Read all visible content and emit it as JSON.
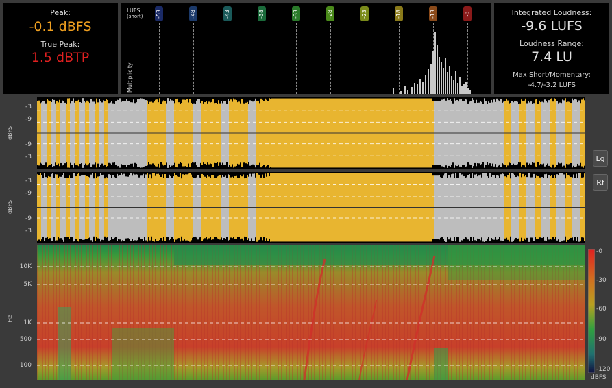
{
  "peak": {
    "peak_label": "Peak:",
    "peak_value": "-0.1 dBFS",
    "true_peak_label": "True Peak:",
    "true_peak_value": "1.5 dBTP"
  },
  "histogram": {
    "axis_label_line1": "LUFS",
    "axis_label_line2": "(short)",
    "y_label": "Multiplicity",
    "ticks": [
      {
        "label": "-53",
        "color": "#1a2a66"
      },
      {
        "label": "-48",
        "color": "#1c3a6a"
      },
      {
        "label": "-43",
        "color": "#1a5a5a"
      },
      {
        "label": "-38",
        "color": "#1a6a3a"
      },
      {
        "label": "-33",
        "color": "#2a7a2a"
      },
      {
        "label": "-28",
        "color": "#4a8a1a"
      },
      {
        "label": "-23",
        "color": "#7a8a1a"
      },
      {
        "label": "-18",
        "color": "#8a7a1a"
      },
      {
        "label": "-13",
        "color": "#8a4a1a"
      },
      {
        "label": "-8",
        "color": "#8a1a1a"
      }
    ]
  },
  "loudness": {
    "integrated_label": "Integrated Loudness:",
    "integrated_value": "-9.6 LUFS",
    "range_label": "Loudness Range:",
    "range_value": "7.4 LU",
    "max_label": "Max Short/Momentary:",
    "max_value": "-4.7/-3.2 LUFS"
  },
  "waveform": {
    "axis_title": "dBFS",
    "ticks": [
      "-3",
      "-9",
      "-9",
      "-3"
    ]
  },
  "spectrogram": {
    "axis_title": "Hz",
    "ticks": [
      "10K",
      "5K",
      "1K",
      "500",
      "100"
    ],
    "scale_ticks": [
      "-0",
      "-30",
      "-60",
      "-90",
      "-120"
    ],
    "scale_unit": "dBFS"
  },
  "buttons": {
    "log_label": "Lg",
    "rectified_label": "Rf"
  },
  "colors": {
    "peak_value": "#f0a020",
    "true_peak_value": "#e02020",
    "waveform_fill": "#e8b530",
    "waveform_grey": "#bdbdbd"
  }
}
